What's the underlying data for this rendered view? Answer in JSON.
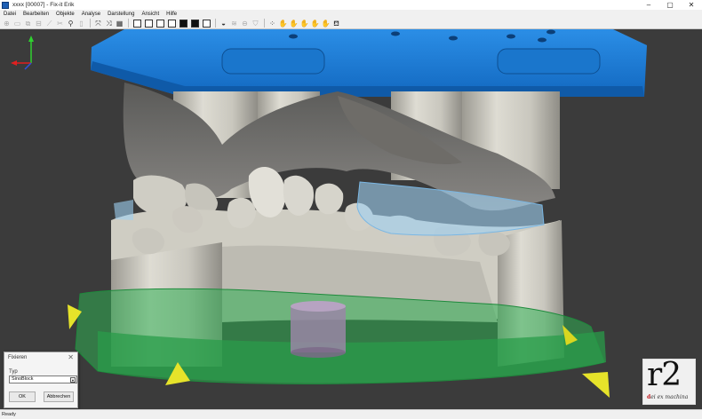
{
  "window": {
    "title": "xxxx [00007] - Fix-it Erik",
    "controls": [
      "–",
      "▢",
      "✕"
    ]
  },
  "menu": {
    "items": [
      "Datei",
      "Bearbeiten",
      "Objekte",
      "Analyse",
      "Darstellung",
      "Ansicht",
      "Hilfe"
    ]
  },
  "toolbar": {
    "icons": [
      "rotate-icon",
      "select-icon",
      "copy-icon",
      "align-icon",
      "measure-icon",
      "zoom-icon",
      "fit-icon",
      "expand-icon",
      "collapse-icon",
      "grid-icon",
      "view-front-icon",
      "view-back-icon",
      "view-left-icon",
      "view-right-icon",
      "view-top-icon",
      "view-bottom-icon",
      "disc-icon",
      "layer-icon",
      "model-icon",
      "hand-icon",
      "hand2-icon",
      "hand3-icon",
      "hand4-icon",
      "hand5-icon",
      "cup-icon"
    ]
  },
  "dialog": {
    "title": "Fixieren",
    "close": "✕",
    "type_label": "Typ",
    "type_value": "SinoBlock",
    "ok_label": "OK",
    "cancel_label": "Abbrechen"
  },
  "status": {
    "text": "Ready"
  },
  "logo": {
    "main": "r2",
    "accent": "d",
    "tagline": "ei ex machina"
  },
  "colors": {
    "articulator_blue": "#1d7fd6",
    "fixation_green": "#2fae52",
    "marker_yellow": "#e6e32a",
    "model_stone": "#d8d6cc",
    "pin_purple": "#9a86a6",
    "viewport_bg": "#3b3b3b"
  }
}
